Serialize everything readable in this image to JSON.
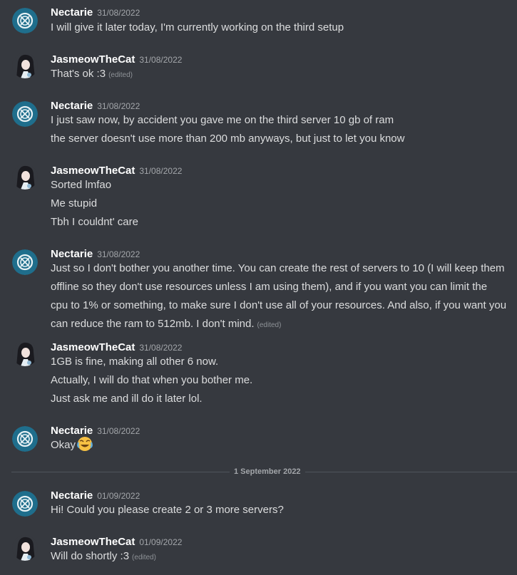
{
  "messages": [
    {
      "author": "Nectarie",
      "avatar": "nectarie-logo-icon",
      "timestamp": "31/08/2022",
      "lines": [
        {
          "text": "I will give it later today, I'm currently working on the third setup",
          "edited": ""
        }
      ]
    },
    {
      "author": "JasmeowTheCat",
      "avatar": "jasmeow-avatar-icon",
      "timestamp": "31/08/2022",
      "lines": [
        {
          "text": "That's ok :3",
          "edited": "(edited)"
        }
      ]
    },
    {
      "author": "Nectarie",
      "avatar": "nectarie-logo-icon",
      "timestamp": "31/08/2022",
      "lines": [
        {
          "text": "I just saw now, by accident you gave me on the third server 10 gb of ram",
          "edited": ""
        },
        {
          "text": "the server doesn't use more than 200 mb anyways, but just to let you know",
          "edited": ""
        }
      ]
    },
    {
      "author": "JasmeowTheCat",
      "avatar": "jasmeow-avatar-icon",
      "timestamp": "31/08/2022",
      "lines": [
        {
          "text": "Sorted lmfao",
          "edited": ""
        },
        {
          "text": "Me stupid",
          "edited": ""
        },
        {
          "text": "Tbh I couldnt' care",
          "edited": ""
        }
      ]
    },
    {
      "author": "Nectarie",
      "avatar": "nectarie-logo-icon",
      "timestamp": "31/08/2022",
      "lines": [
        {
          "text": "Just so I don't bother you another time. You can create the rest of servers to 10 (I will keep them offline so they don't use resources unless I am using them), and if you want you can limit the cpu to 1% or something, to make sure I don't use all of your resources. And also, if you want you can reduce the ram to 512mb. I don't mind.",
          "edited": "(edited)"
        }
      ]
    },
    {
      "author": "JasmeowTheCat",
      "avatar": "jasmeow-avatar-icon",
      "timestamp": "31/08/2022",
      "lines": [
        {
          "text": "1GB is fine, making all other 6 now.",
          "edited": ""
        },
        {
          "text": "Actually, I will do that when you bother me.",
          "edited": ""
        },
        {
          "text": "Just ask me and ill do it later lol.",
          "edited": ""
        }
      ]
    },
    {
      "author": "Nectarie",
      "avatar": "nectarie-logo-icon",
      "timestamp": "31/08/2022",
      "lines": [
        {
          "text": "Okay",
          "edited": "",
          "emoji": "joy-emoji-icon"
        }
      ]
    },
    {
      "author": "Nectarie",
      "avatar": "nectarie-logo-icon",
      "timestamp": "01/09/2022",
      "lines": [
        {
          "text": "Hi! Could you please create 2 or 3 more servers?",
          "edited": ""
        }
      ]
    },
    {
      "author": "JasmeowTheCat",
      "avatar": "jasmeow-avatar-icon",
      "timestamp": "01/09/2022",
      "lines": [
        {
          "text": "Will do shortly :3",
          "edited": "(edited)"
        }
      ]
    }
  ],
  "date_divider": "1 September 2022",
  "colors": {
    "background": "#36393f",
    "author": "#ffffff",
    "text": "#dcddde",
    "timestamp": "#a3a6aa",
    "nectarie_avatar_bg": "#1f6e8c"
  }
}
